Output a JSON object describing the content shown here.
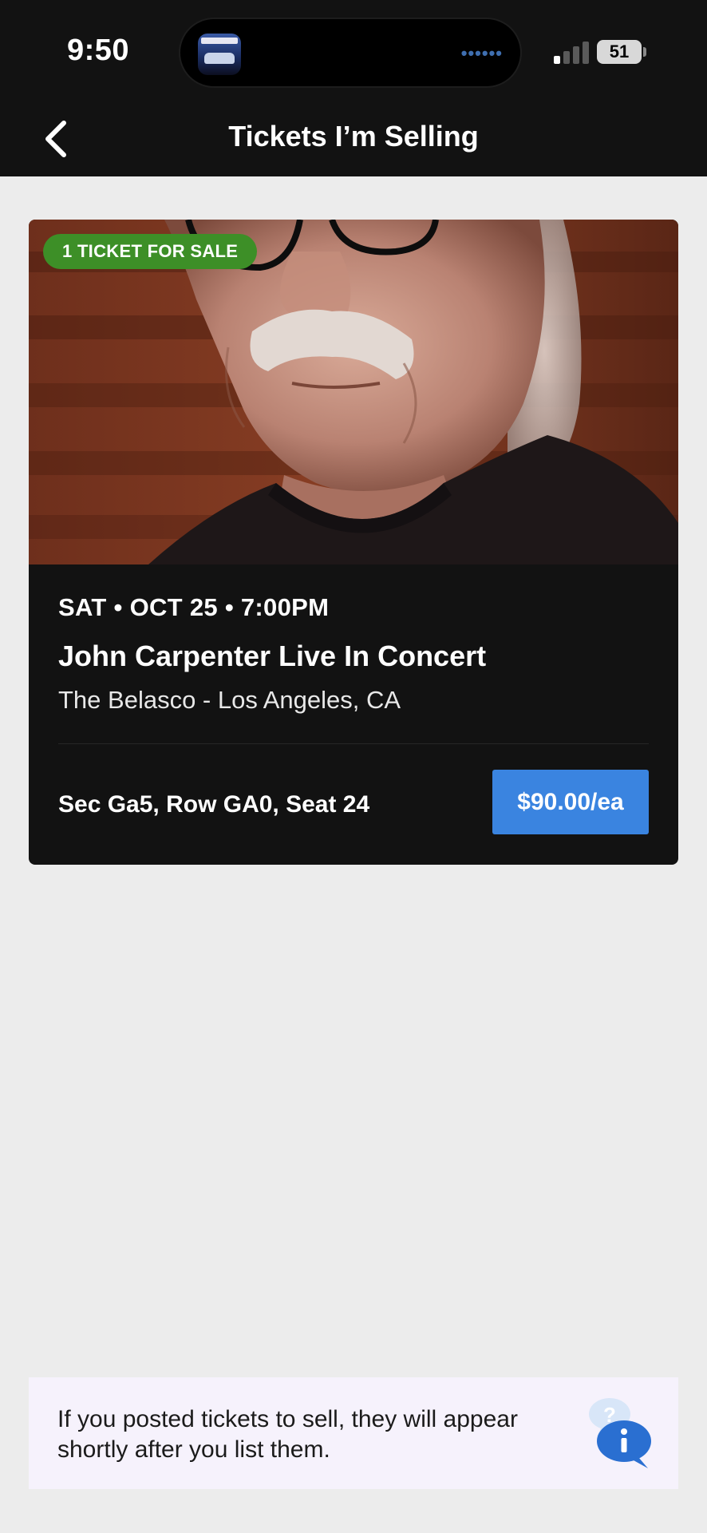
{
  "status_bar": {
    "time": "9:50",
    "battery": "51",
    "icons": [
      "app-icon",
      "signal-icon",
      "battery-icon"
    ]
  },
  "header": {
    "title": "Tickets I’m Selling",
    "back_icon": "chevron-left-icon"
  },
  "event": {
    "badge": "1 TICKET FOR SALE",
    "datetime": "SAT • OCT 25 • 7:00PM",
    "title": "John Carpenter Live In Concert",
    "venue": "The Belasco - Los Angeles, CA",
    "seat": "Sec Ga5, Row GA0, Seat 24",
    "price": "$90.00/ea",
    "image": "performer-photo"
  },
  "info_banner": {
    "text": "If you posted tickets to sell, they will appear shortly after you list them.",
    "icon": "help-chat-icon"
  },
  "colors": {
    "header_bg": "#121212",
    "page_bg": "#ececec",
    "badge_green": "#3d8f27",
    "price_blue": "#3a84e0",
    "banner_bg": "#f6f2fc"
  }
}
